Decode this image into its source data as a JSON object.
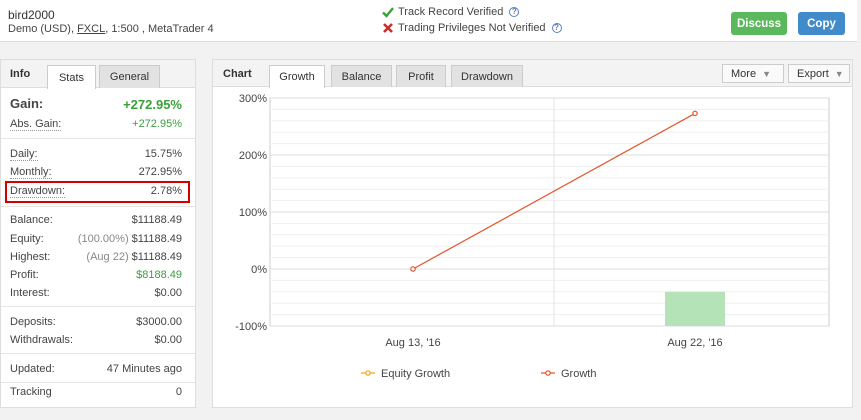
{
  "header": {
    "account_name": "bird2000",
    "account_type": "Demo (USD),",
    "broker": "FXCL",
    "details": ", 1:500 , MetaTrader 4",
    "track_record": "Track Record Verified",
    "trading_privileges": "Trading Privileges Not Verified",
    "discuss_label": "Discuss",
    "copy_label": "Copy"
  },
  "left": {
    "title": "Info",
    "tabs": [
      "Stats",
      "General"
    ],
    "gain_label": "Gain:",
    "gain_value": "+272.95%",
    "abs_gain_label": "Abs. Gain:",
    "abs_gain_value": "+272.95%",
    "daily_label": "Daily:",
    "daily_value": "15.75%",
    "monthly_label": "Monthly:",
    "monthly_value": "272.95%",
    "drawdown_label": "Drawdown:",
    "drawdown_value": "2.78%",
    "balance_label": "Balance:",
    "balance_value": "$11188.49",
    "equity_label": "Equity:",
    "equity_note": "(100.00%)",
    "equity_value": "$11188.49",
    "highest_label": "Highest:",
    "highest_note": "(Aug 22)",
    "highest_value": "$11188.49",
    "profit_label": "Profit:",
    "profit_value": "$8188.49",
    "interest_label": "Interest:",
    "interest_value": "$0.00",
    "deposits_label": "Deposits:",
    "deposits_value": "$3000.00",
    "withdrawals_label": "Withdrawals:",
    "withdrawals_value": "$0.00",
    "updated_label": "Updated:",
    "updated_value": "47 Minutes ago",
    "tracking_label": "Tracking",
    "tracking_value": "0"
  },
  "right": {
    "title": "Chart",
    "tabs": [
      "Growth",
      "Balance",
      "Profit",
      "Drawdown"
    ],
    "more_label": "More",
    "export_label": "Export"
  },
  "colors": {
    "growth_line": "#e0542a",
    "equity_growth": "#f2a30f",
    "bar_fill": "#b3e3b6",
    "green_text": "#3aa03a",
    "highlight_box": "#d40000"
  },
  "chart_data": {
    "type": "line",
    "x": [
      "Aug 13, '16",
      "Aug 22, '16"
    ],
    "y_ticks": [
      "300%",
      "200%",
      "100%",
      "0%",
      "-100%"
    ],
    "ylim": [
      -100,
      300
    ],
    "series": [
      {
        "name": "Equity Growth",
        "values": []
      },
      {
        "name": "Growth",
        "values": [
          0,
          272.95
        ]
      }
    ],
    "bars": [
      {
        "x": "Aug 22, '16",
        "value": -40
      }
    ],
    "legend_position": "bottom"
  }
}
